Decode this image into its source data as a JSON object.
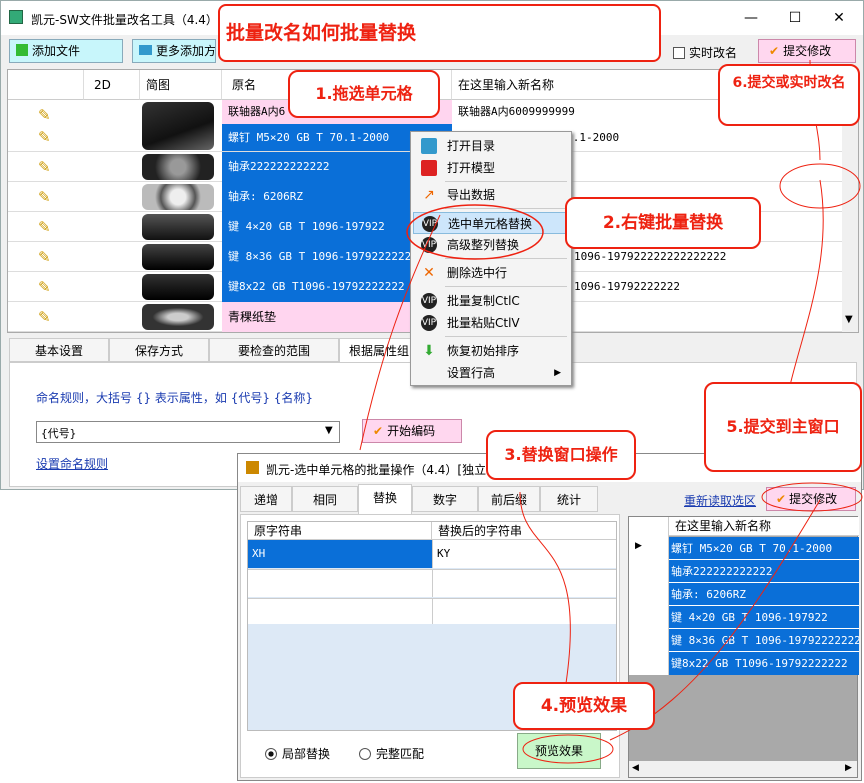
{
  "main_window": {
    "title": "凯元-SW文件批量改名工具（4.4）",
    "window_controls": [
      "—",
      "☐",
      "✕"
    ]
  },
  "toolbar": {
    "add_file": "添加文件",
    "add_more": "更多添加方",
    "realtime_rename": "实时改名",
    "submit": "提交修改"
  },
  "grid": {
    "headers": [
      "2D",
      "简图",
      "原名",
      "在这里输入新名称"
    ],
    "rows": [
      {
        "orig": "联轴器A内6",
        "new": "联轴器A内6009999999",
        "selected": false
      },
      {
        "orig": "螺钉 M5×20 GB T 70.1-2000",
        "new": "螺钉 M5×20 GB T 70.1-2000",
        "selected": true
      },
      {
        "orig": "轴承222222222222",
        "new": "",
        "selected": true
      },
      {
        "orig": "轴承: 6206RZ",
        "new": "",
        "selected": true
      },
      {
        "orig": "键 4×20 GB T 1096-197922",
        "new": "",
        "selected": true
      },
      {
        "orig": "键 8×36 GB T 1096-197922222222",
        "new": "1096-197922222222222222",
        "selected": true
      },
      {
        "orig": "键8x22 GB T1096-19792222222",
        "new": "1096-19792222222",
        "selected": true
      },
      {
        "orig": "青稞纸垫",
        "new": "",
        "selected": false
      }
    ]
  },
  "bottom_tabs": [
    "基本设置",
    "保存方式",
    "要检查的范围",
    "根据属性组"
  ],
  "naming": {
    "rule_label": "命名规则，大括号 {} 表示属性，如 {代号} {名称}",
    "rule_value": "{代号}",
    "start_button": "开始编码",
    "settings_link": "设置命名规则"
  },
  "context_menu": {
    "items": [
      "打开目录",
      "打开模型",
      "导出数据",
      "选中单元格替换",
      "高级整列替换",
      "删除选中行",
      "批量复制CtlC",
      "批量粘贴CtlV",
      "恢复初始排序",
      "设置行高"
    ]
  },
  "sub_window": {
    "title": "凯元-选中单元格的批量操作（4.4）[独立",
    "tabs": [
      "递增",
      "相同",
      "替换",
      "数字",
      "前后缀",
      "统计"
    ],
    "active_tab": "替换",
    "reload_link": "重新读取选区",
    "submit": "提交修改",
    "replace_headers": [
      "原字符串",
      "替换后的字符串"
    ],
    "replace_rows": [
      [
        "XH",
        "KY"
      ],
      [
        "",
        ""
      ],
      [
        "",
        ""
      ]
    ],
    "preview_header": "在这里输入新名称",
    "preview_rows": [
      "螺钉 M5×20 GB T 70.1-2000",
      "轴承222222222222",
      "轴承: 6206RZ",
      "键 4×20 GB T 1096-197922",
      "键 8×36 GB T 1096-197922222222",
      "键8x22 GB T1096-19792222222"
    ],
    "radio_partial": "局部替换",
    "radio_full": "完整匹配",
    "preview_button": "预览效果"
  },
  "annotations": {
    "title": "批量改名如何批量替换",
    "step1": "1.拖选单元格",
    "step2": "2.右键批量替换",
    "step3": "3.替换窗口操作",
    "step4": "4.预览效果",
    "step5": "5.提交到主窗口",
    "step6": "6.提交或实时改名"
  },
  "colors": {
    "selection": "#0a6fd8",
    "annotation": "#e21111",
    "pink": "#ffd5ef"
  }
}
